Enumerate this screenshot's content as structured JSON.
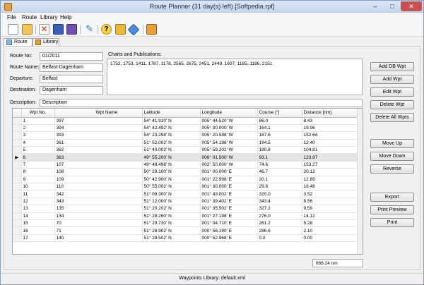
{
  "window": {
    "title": "Route Planner (31 day(s) left) [Softpedia.rpf]"
  },
  "menu": [
    "File",
    "Route",
    "Library",
    "Help"
  ],
  "toolbar": {
    "buttons": [
      "new-icon",
      "open-icon",
      "delete-icon",
      "save-icon",
      "save-as-icon",
      "tools-icon",
      "help-icon",
      "lock-icon",
      "compass-icon",
      "book-icon"
    ]
  },
  "tabs": [
    {
      "label": "Route",
      "active": true
    },
    {
      "label": "Library",
      "active": false
    }
  ],
  "route": {
    "route_no_label": "Route No:",
    "route_no": "01/2011",
    "route_name_label": "Route Name:",
    "route_name": "Belfast-Dagenham",
    "departure_label": "Departure:",
    "departure": "Belfast",
    "destination_label": "Destination:",
    "destination": "Dagenham",
    "description_label": "Description:",
    "description": "Description",
    "charts_label": "Charts and Publications:",
    "charts": "1752, 1753, 1411, 1787, 1178, 2565, 2675, 2451, 2449, 1607, 1185, 1186, 2151"
  },
  "buttons": {
    "add_db": "Add DB Wpt",
    "add": "Add Wpt",
    "edit": "Edit Wpt",
    "delete": "Delete Wpt",
    "delete_all": "Delete All Wpts",
    "move_up": "Move Up",
    "move_down": "Move Down",
    "reverse": "Reverse",
    "export": "Export",
    "print_preview": "Print Preview",
    "print": "Print"
  },
  "table": {
    "columns": [
      "Wpt No.",
      "Wpt Name",
      "Latitude",
      "Longitude",
      "Course [°]",
      "Distance [nm]"
    ],
    "current_row": 5,
    "rows": [
      [
        "1",
        "397",
        "54° 41.910' N",
        "005° 44.520' W",
        "86.0",
        "8.43"
      ],
      [
        "2",
        "394",
        "54° 42.492' N",
        "005° 30.000' W",
        "164.1",
        "19.96"
      ],
      [
        "3",
        "393",
        "54° 23.298' N",
        "005° 20.598' W",
        "187.6",
        "152.64"
      ],
      [
        "4",
        "361",
        "51° 52.002' N",
        "005° 54.198' W",
        "194.5",
        "12.40"
      ],
      [
        "5",
        "362",
        "51° 40.002' N",
        "005° 59.202' W",
        "180.8",
        "104.81"
      ],
      [
        "6",
        "363",
        "49° 55.200' N",
        "006° 01.500' W",
        "93.1",
        "123.97"
      ],
      [
        "7",
        "107",
        "49° 48.498' N",
        "002° 50.000' W",
        "74.6",
        "153.27"
      ],
      [
        "8",
        "108",
        "50° 29.100' N",
        "001° 00.000' E",
        "46.7",
        "20.12"
      ],
      [
        "9",
        "109",
        "50° 42.900' N",
        "001° 22.998' E",
        "20.1",
        "12.89"
      ],
      [
        "10",
        "110",
        "50° 55.002' N",
        "001° 30.000' E",
        "29.8",
        "16.48"
      ],
      [
        "11",
        "342",
        "51° 09.300' N",
        "001° 43.002' E",
        "320.0",
        "3.52"
      ],
      [
        "12",
        "343",
        "51° 12.000' N",
        "001° 39.402' E",
        "343.4",
        "8.56"
      ],
      [
        "13",
        "135",
        "51° 20.202' N",
        "001° 35.502' E",
        "327.2",
        "9.59"
      ],
      [
        "14",
        "134",
        "51° 28.260' N",
        "001° 27.198' E",
        "276.0",
        "14.12"
      ],
      [
        "15",
        "70",
        "51° 29.730' N",
        "001° 04.710' E",
        "261.2",
        "5.28"
      ],
      [
        "16",
        "71",
        "51° 28.902' N",
        "000° 56.190' E",
        "286.6",
        "2.10"
      ],
      [
        "17",
        "140",
        "51° 29.502' N",
        "000° 52.968' E",
        "0.0",
        "0.00"
      ]
    ]
  },
  "total_distance": "668.24 nm",
  "status": "Waypoints Library: default.xml"
}
